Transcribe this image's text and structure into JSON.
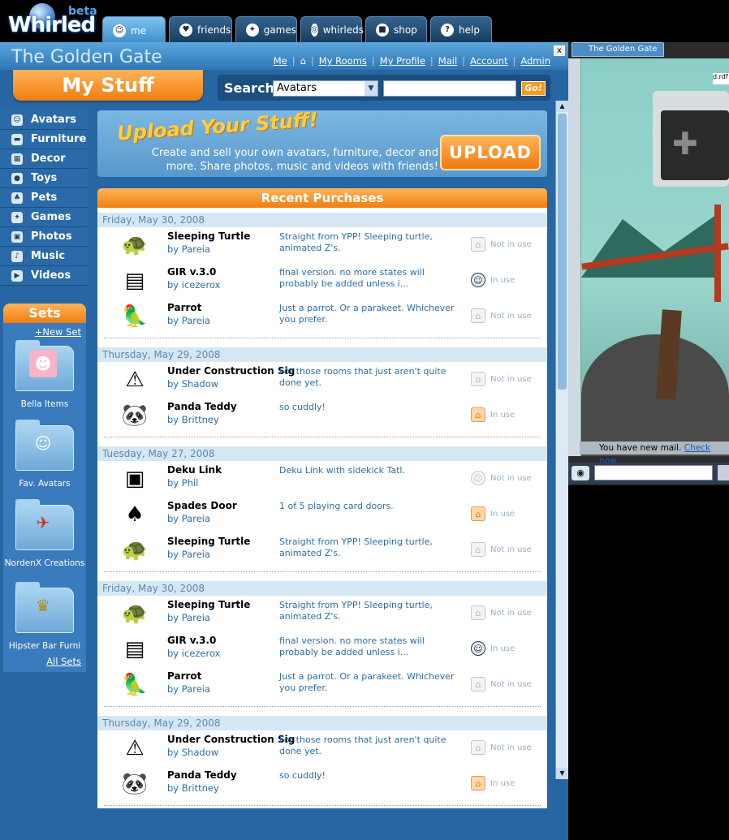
{
  "app": {
    "logo_text": "Whirled",
    "logo_badge": "beta"
  },
  "tabs": [
    {
      "label": "me",
      "icon": "me-icon",
      "active": true
    },
    {
      "label": "friends",
      "icon": "friends-icon"
    },
    {
      "label": "games",
      "icon": "games-icon"
    },
    {
      "label": "whirleds",
      "icon": "whirleds-icon"
    },
    {
      "label": "shop",
      "icon": "shop-icon"
    },
    {
      "label": "help",
      "icon": "help-icon"
    }
  ],
  "header": {
    "room_title": "The Golden Gate",
    "links": [
      "Me",
      "My Rooms",
      "My Profile",
      "Mail",
      "Account",
      "Admin"
    ],
    "close_label": "x"
  },
  "page_title": "My Stuff",
  "search": {
    "label": "Search",
    "category": "Avatars",
    "query": "",
    "go_label": "Go!"
  },
  "nav": [
    {
      "label": "Avatars",
      "icon": "avatar-icon"
    },
    {
      "label": "Furniture",
      "icon": "furniture-icon"
    },
    {
      "label": "Decor",
      "icon": "decor-icon"
    },
    {
      "label": "Toys",
      "icon": "toys-icon"
    },
    {
      "label": "Pets",
      "icon": "pets-icon"
    },
    {
      "label": "Games",
      "icon": "games-icon"
    },
    {
      "label": "Photos",
      "icon": "photos-icon"
    },
    {
      "label": "Music",
      "icon": "music-icon"
    },
    {
      "label": "Videos",
      "icon": "videos-icon"
    }
  ],
  "sets": {
    "title": "Sets",
    "new_label": "+New Set",
    "items": [
      "Bella Items",
      "Fav. Avatars",
      "NordenX Creations",
      "Hipster Bar Furni"
    ],
    "all_label": "All Sets"
  },
  "upload": {
    "title": "Upload Your Stuff!",
    "description": "Create and sell your own avatars, furniture, decor and more. Share photos, music and videos with friends!",
    "button": "UPLOAD"
  },
  "purchases": {
    "title": "Recent Purchases",
    "days": [
      {
        "date": "Friday, May 30, 2008",
        "items": [
          {
            "name": "Sleeping Turtle",
            "creator": "by Pareia",
            "desc": "Straight from YPP! Sleeping turtle, animated Z's.",
            "status": "Not in use",
            "status_icon": "home-icon"
          },
          {
            "name": "GIR v.3.0",
            "creator": "by icezerox",
            "desc": "final version. no more states will probably be added unless i...",
            "status": "In use",
            "status_icon": "avatar-in-use-icon"
          },
          {
            "name": "Parrot",
            "creator": "by Pareia",
            "desc": "Just a parrot. Or a parakeet. Whichever you prefer.",
            "status": "Not in use",
            "status_icon": "home-icon"
          }
        ]
      },
      {
        "date": "Thursday, May 29, 2008",
        "items": [
          {
            "name": "Under Construction Sig",
            "creator": "by Shadow",
            "desc": "For those rooms that just aren't quite done yet.",
            "status": "Not in use",
            "status_icon": "home-icon"
          },
          {
            "name": "Panda Teddy",
            "creator": "by Brittney",
            "desc": "so cuddly!",
            "status": "In use",
            "status_icon": "home-in-use-icon"
          }
        ]
      },
      {
        "date": "Tuesday, May 27, 2008",
        "items": [
          {
            "name": "Deku Link",
            "creator": "by Phil",
            "desc": "Deku Link with sidekick Tatl.",
            "status": "Not in use",
            "status_icon": "avatar-icon"
          },
          {
            "name": "Spades Door",
            "creator": "by Pareia",
            "desc": "1 of 5 playing card doors.",
            "status": "In use",
            "status_icon": "home-in-use-icon"
          },
          {
            "name": "Sleeping Turtle",
            "creator": "by Pareia",
            "desc": "Straight from YPP! Sleeping turtle, animated Z's.",
            "status": "Not in use",
            "status_icon": "home-icon"
          }
        ]
      },
      {
        "date": "Friday, May 30, 2008",
        "items": [
          {
            "name": "Sleeping Turtle",
            "creator": "by Pareia",
            "desc": "Straight from YPP! Sleeping turtle, animated Z's.",
            "status": "Not in use",
            "status_icon": "home-icon"
          },
          {
            "name": "GIR v.3.0",
            "creator": "by icezerox",
            "desc": "final version. no more states will probably be added unless i...",
            "status": "In use",
            "status_icon": "avatar-in-use-icon"
          },
          {
            "name": "Parrot",
            "creator": "by Pareia",
            "desc": "Just a parrot. Or a parakeet. Whichever you prefer.",
            "status": "Not in use",
            "status_icon": "home-icon"
          }
        ]
      },
      {
        "date": "Thursday, May 29, 2008",
        "items": [
          {
            "name": "Under Construction Sig",
            "creator": "by Shadow",
            "desc": "For those rooms that just aren't quite done yet.",
            "status": "Not in use",
            "status_icon": "home-icon"
          },
          {
            "name": "Panda Teddy",
            "creator": "by Brittney",
            "desc": "so cuddly!",
            "status": "In use",
            "status_icon": "home-in-use-icon"
          }
        ]
      }
    ]
  },
  "room": {
    "tab_label": "The Golden Gate",
    "mail_notice": "You have new mail.",
    "mail_link": "Check now",
    "corner_label": "d.rdf"
  },
  "colors": {
    "accent": "#f07e10",
    "panel": "#2666a3",
    "link": "#2e6ca8"
  }
}
